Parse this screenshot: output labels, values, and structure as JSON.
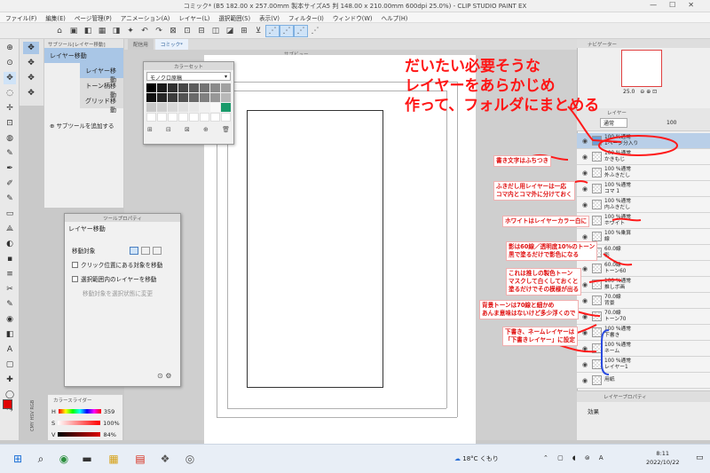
{
  "window": {
    "title": "コミック* (B5 182.00 x 257.00mm 製本サイズA5 判 148.00 x 210.00mm 600dpi 25.0%) - CLIP STUDIO PAINT EX",
    "controls": [
      "—",
      "☐",
      "✕"
    ]
  },
  "menu": [
    "ファイル(F)",
    "編集(E)",
    "ページ管理(P)",
    "アニメーション(A)",
    "レイヤー(L)",
    "選択範囲(S)",
    "表示(V)",
    "フィルター(I)",
    "ウィンドウ(W)",
    "ヘルプ(H)"
  ],
  "toolbar_icons": [
    "⌂",
    "▣",
    "◧",
    "▦",
    "◨",
    "✦",
    "↶",
    "↷",
    "⊠",
    "⊡",
    "⊟",
    "◫",
    "◪",
    "⊞",
    "⊻",
    "⋰",
    "⋰",
    "⋰",
    "⋰"
  ],
  "left_tools": [
    "⊕",
    "⊙",
    "✥",
    "◌",
    "✢",
    "⊡",
    "◍",
    "✎",
    "✒",
    "✐",
    "✎",
    "▭",
    "⟁",
    "◐",
    "▪",
    "≡",
    "✂",
    "✎",
    "◉",
    "◧",
    "A",
    "▢",
    "✚",
    "◯",
    "⤳"
  ],
  "subtool_icons": [
    "✥",
    "✥",
    "✥",
    "✥"
  ],
  "subtool_panel": {
    "header": "サブツール[レイヤー移動]",
    "items": [
      "レイヤー移動",
      "レイヤー移動",
      "トーン柄移動",
      "グリッド移動"
    ],
    "add": "サブツールを追加する"
  },
  "canvas_tabs": [
    "配信用",
    "コミック*"
  ],
  "canvas_title": "サブビュー",
  "color_set": {
    "header": "カラーセット",
    "selected": "モノクロ原稿",
    "swatches": [
      "#000000",
      "#1a1a1a",
      "#303030",
      "#464646",
      "#5c5c5c",
      "#737373",
      "#8a8a8a",
      "#a1a1a1",
      "#111111",
      "#272727",
      "#3d3d3d",
      "#535353",
      "#6a6a6a",
      "#808080",
      "#979797",
      "#b8b8b8",
      "#c8c8c8",
      "#d0d0d0",
      "#d8d8d8",
      "#e0e0e0",
      "#e8e8e8",
      "#f0f0f0",
      "#f8f8f8",
      "#1a9a6a",
      "#ffffff",
      "#ffffff",
      "#ffffff",
      "#ffffff",
      "#ffffff",
      "#ffffff",
      "#ffffff",
      "#ffffff"
    ],
    "footer_icons": [
      "⊞",
      "⊟",
      "⊠",
      "⊕",
      "🗑"
    ]
  },
  "tool_property": {
    "header": "ツールプロパティ",
    "name": "レイヤー移動",
    "target_label": "移動対象",
    "option1": "クリック位置にある対象を移動",
    "option2": "選択範囲内のレイヤーを移動",
    "option3": "移動対象を選択状態に変更"
  },
  "color_slider": {
    "header": "カラースライダー",
    "rows": [
      {
        "label": "H",
        "value": "359",
        "gradient": "linear-gradient(90deg,#f00,#ff0,#0f0,#0ff,#00f,#f0f,#f00)"
      },
      {
        "label": "S",
        "value": "100%",
        "gradient": "linear-gradient(90deg,#fff,#f00)"
      },
      {
        "label": "V",
        "value": "84%",
        "gradient": "linear-gradient(90deg,#000,#d00)"
      }
    ],
    "tabs": "CMY HSV RGB",
    "main_color": "#e00000"
  },
  "right": {
    "navigator": "ナビゲーター",
    "zoom": "25.0",
    "angle": "0.0",
    "layer_header": "レイヤー",
    "blend": "通常",
    "opacity": "100",
    "layers": [
      {
        "name": "100 %通常\n1ページ分入り",
        "selected": true,
        "folder": true
      },
      {
        "name": "100 %通常\nかきもじ"
      },
      {
        "name": "100 %通常\n外ふきだし"
      },
      {
        "name": "100 %通常\nコマ 1"
      },
      {
        "name": "100 %通常\n内ふきだし"
      },
      {
        "name": "100 %通常\nホワイト"
      },
      {
        "name": "100 %乗算\n線"
      },
      {
        "name": "60.0線\n影"
      },
      {
        "name": "60.0線\nトーン60"
      },
      {
        "name": "100 %通常\n推しボ画"
      },
      {
        "name": "70.0線\n背景"
      },
      {
        "name": "70.0線\nトーン70"
      },
      {
        "name": "100 %通常\n下書き"
      },
      {
        "name": "100 %通常\nネーム"
      },
      {
        "name": "100 %通常\nレイヤー1"
      },
      {
        "name": "用紙"
      }
    ],
    "layer_property": "レイヤープロパティ",
    "effect": "効果"
  },
  "annotations": {
    "big": [
      "だいたい必要そうな",
      "レイヤーをあらかじめ",
      "作って、フォルダにまとめる"
    ],
    "a1": "書き文字はふちつき",
    "a2": [
      "ふきだし用レイヤーは一応",
      "コマ内とコマ外に分けておく"
    ],
    "a3": "ホワイトはレイヤーカラー白に",
    "a4": [
      "影は60線／透明度10%のトーン",
      "黒で塗るだけで影色になる"
    ],
    "a5": [
      "これは推しの製色トーン",
      "マスクして白くしておくと",
      "塗るだけでその模様が出る"
    ],
    "a6": [
      "背景トーンは70線と細かめ",
      "あんま意味はないけど多少浮くので"
    ],
    "a7": [
      "下書き、ネームレイヤーは",
      "「下書きレイヤー」に設定"
    ]
  },
  "taskbar": {
    "weather": "18°C くもり",
    "time": "8:11",
    "date": "2022/10/22",
    "apps": [
      "⊞",
      "⌕",
      "◉",
      "▬",
      "▦",
      "▤",
      "❖",
      "◎"
    ],
    "tray": "⌃ ▢ ◖ ⊜ A"
  }
}
